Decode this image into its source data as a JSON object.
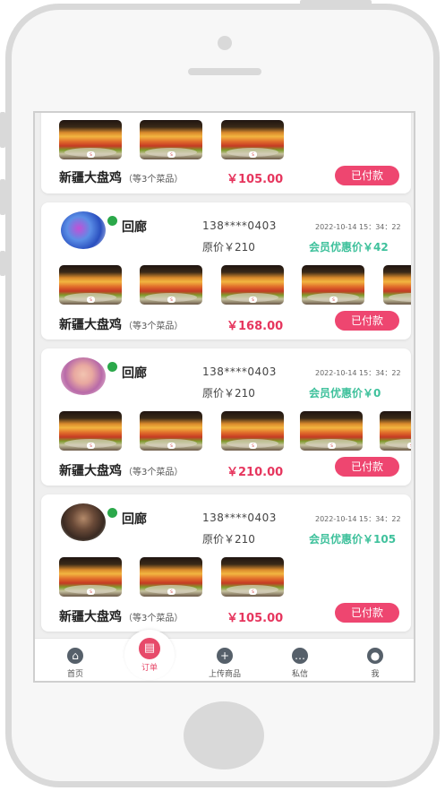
{
  "orders": [
    {
      "id": "order-1",
      "partial": true,
      "thumbs": [
        1,
        1,
        1
      ],
      "dish": "新疆大盘鸡",
      "dish_count": "（等3个菜品）",
      "price": "￥105.00",
      "status": "已付款"
    },
    {
      "id": "order-2",
      "name": "回廊",
      "phone": "138****0403",
      "time": "2022-10-14  15：34：22",
      "original_price": "原价￥210",
      "member_price": "会员优惠价￥42",
      "thumbs": [
        1,
        1,
        1,
        1,
        1
      ],
      "dish": "新疆大盘鸡",
      "dish_count": "（等3个菜品）",
      "price": "￥168.00",
      "status": "已付款"
    },
    {
      "id": "order-3",
      "name": "回廊",
      "phone": "138****0403",
      "time": "2022-10-14  15：34：22",
      "original_price": "原价￥210",
      "member_price": "会员优惠价￥0",
      "thumbs": [
        1,
        1,
        1,
        1,
        1
      ],
      "dish": "新疆大盘鸡",
      "dish_count": "（等3个菜品）",
      "price": "￥210.00",
      "status": "已付款"
    },
    {
      "id": "order-4",
      "name": "回廊",
      "phone": "138****0403",
      "time": "2022-10-14  15：34：22",
      "original_price": "原价￥210",
      "member_price": "会员优惠价￥105",
      "thumbs": [
        1,
        1,
        1
      ],
      "dish": "新疆大盘鸡",
      "dish_count": "（等3个菜品）",
      "price": "￥105.00",
      "status": "已付款"
    }
  ],
  "tabbar": {
    "home": "首页",
    "orders": "订单",
    "upload": "上传商品",
    "messages": "私信",
    "me": "我"
  },
  "colors": {
    "accent": "#e6365e",
    "member": "#3fc19c",
    "online": "#2ba84a"
  }
}
